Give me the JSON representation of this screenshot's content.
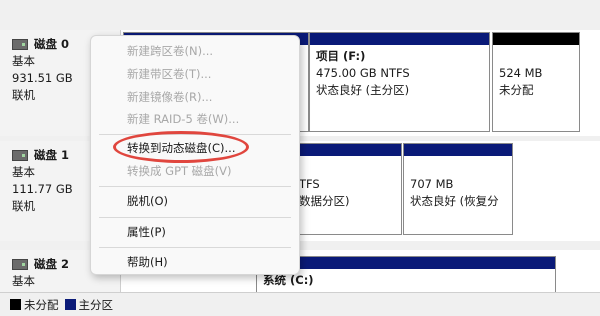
{
  "disks": [
    {
      "name": "磁盘 0",
      "type": "基本",
      "size": "931.51 GB",
      "status": "联机"
    },
    {
      "name": "磁盘 1",
      "type": "基本",
      "size": "111.77 GB",
      "status": "联机"
    },
    {
      "name": "磁盘 2",
      "type": "基本"
    }
  ],
  "disk0_partitions": [
    {
      "title": "项目  (F:)",
      "size": "475.00 GB NTFS",
      "status": "状态良好 (主分区)"
    },
    {
      "size": "524 MB",
      "status": "未分配"
    }
  ],
  "disk1_partitions": [
    {
      "size": "TFS",
      "status": "数据分区)"
    },
    {
      "size": "707 MB",
      "status": "状态良好 (恢复分"
    }
  ],
  "disk2_partitions": [
    {
      "title": "系统  (C:)"
    }
  ],
  "context_menu": {
    "items": [
      {
        "label": "新建跨区卷(N)...",
        "enabled": false
      },
      {
        "label": "新建带区卷(T)...",
        "enabled": false
      },
      {
        "label": "新建镜像卷(R)...",
        "enabled": false
      },
      {
        "label": "新建 RAID-5 卷(W)...",
        "enabled": false
      },
      {
        "label": "转换到动态磁盘(C)...",
        "enabled": true
      },
      {
        "label": "转换成 GPT 磁盘(V)",
        "enabled": false
      },
      {
        "label": "脱机(O)",
        "enabled": true
      },
      {
        "label": "属性(P)",
        "enabled": true
      },
      {
        "label": "帮助(H)",
        "enabled": true
      }
    ]
  },
  "legend": [
    {
      "label": "未分配",
      "color": "#000000"
    },
    {
      "label": "主分区",
      "color": "#0a1a78"
    }
  ],
  "colors": {
    "primary_partition": "#0a1a78",
    "unallocated": "#000000",
    "highlight_ring": "#e0463e"
  }
}
